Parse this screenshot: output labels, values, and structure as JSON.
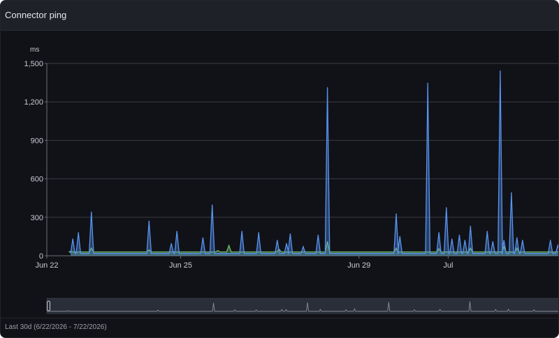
{
  "panel": {
    "title": "Connector ping",
    "footer": "Last 30d (6/22/2026 - 7/22/2026)"
  },
  "colors": {
    "primary_series": "#5794f2",
    "secondary_series": "#73bf69",
    "panel_bg": "#111217",
    "header_bg": "#1e2128",
    "grid": "#3a3d44",
    "text": "#c8ccd2"
  },
  "chart_data": {
    "type": "area",
    "ylabel": "ms",
    "xlabel": "",
    "ylim": [
      0,
      1500
    ],
    "yticks": [
      0,
      300,
      600,
      900,
      1200,
      1500
    ],
    "ytick_labels": [
      "0",
      "300",
      "600",
      "900",
      "1,200",
      "1,500"
    ],
    "xticks": [
      {
        "label": "Jun 22",
        "x": "2026-06-22"
      },
      {
        "label": "Jun 25",
        "x": "2026-06-25"
      },
      {
        "label": "Jun 29",
        "x": "2026-06-29"
      },
      {
        "label": "Jul",
        "x": "2026-07-01"
      }
    ],
    "xlim": [
      "2026-06-22",
      "2026-07-03 12:00"
    ],
    "grid": true,
    "legend": "none",
    "series": [
      {
        "color": "#5794f2",
        "baseline": 18,
        "x": [
          "2026-06-22 14:00",
          "2026-06-22 17:00",
          "2026-06-23 00:00",
          "2026-06-24 07:00",
          "2026-06-24 19:00",
          "2026-06-24 22:00",
          "2026-06-25 12:00",
          "2026-06-25 17:00",
          "2026-06-26 09:00",
          "2026-06-26 18:00",
          "2026-06-27 04:00",
          "2026-06-27 09:00",
          "2026-06-27 11:00",
          "2026-06-27 18:00",
          "2026-06-28 02:00",
          "2026-06-28 07:00",
          "2026-06-29 20:00",
          "2026-06-29 22:00",
          "2026-06-30 13:00",
          "2026-06-30 19:00",
          "2026-06-30 23:00",
          "2026-07-01 02:00",
          "2026-07-01 06:00",
          "2026-07-01 09:00",
          "2026-07-01 12:00",
          "2026-07-01 21:00",
          "2026-07-02 00:00",
          "2026-07-02 04:00",
          "2026-07-02 06:00",
          "2026-07-02 10:00",
          "2026-07-02 13:00",
          "2026-07-02 16:00",
          "2026-07-03 07:00",
          "2026-07-03 11:00"
        ],
        "y": [
          130,
          180,
          340,
          270,
          95,
          190,
          140,
          395,
          190,
          180,
          120,
          95,
          170,
          70,
          160,
          1310,
          325,
          150,
          1345,
          180,
          375,
          130,
          160,
          120,
          230,
          190,
          110,
          1440,
          120,
          490,
          140,
          120,
          120,
          80
        ]
      },
      {
        "color": "#73bf69",
        "baseline": 30,
        "x": [
          "2026-06-22 13:00",
          "2026-06-23 00:00",
          "2026-06-24 07:00",
          "2026-06-25 20:00",
          "2026-06-26 02:00",
          "2026-06-27 05:00",
          "2026-06-28 07:00",
          "2026-06-29 20:00",
          "2026-06-30 19:00",
          "2026-07-01 12:00",
          "2026-07-02 06:00",
          "2026-07-02 13:00"
        ],
        "y": [
          35,
          60,
          45,
          40,
          80,
          50,
          110,
          60,
          55,
          60,
          70,
          60
        ]
      }
    ],
    "navigator": {
      "x": [
        "2026-06-23 06:00",
        "2026-06-28 12:00",
        "2026-07-01 18:00",
        "2026-07-03 00:00",
        "2026-07-04 06:00",
        "2026-07-05 18:00",
        "2026-07-06 00:00",
        "2026-07-07 06:00",
        "2026-07-08 00:00",
        "2026-07-09 12:00",
        "2026-07-10 00:00",
        "2026-07-12 00:00",
        "2026-07-13 12:00",
        "2026-07-15 00:00",
        "2026-07-16 18:00",
        "2026-07-18 06:00",
        "2026-07-19 00:00",
        "2026-07-20 12:00"
      ],
      "y": [
        150,
        200,
        1250,
        250,
        220,
        300,
        280,
        1300,
        300,
        250,
        380,
        1350,
        260,
        300,
        1440,
        280,
        320,
        250
      ]
    }
  }
}
